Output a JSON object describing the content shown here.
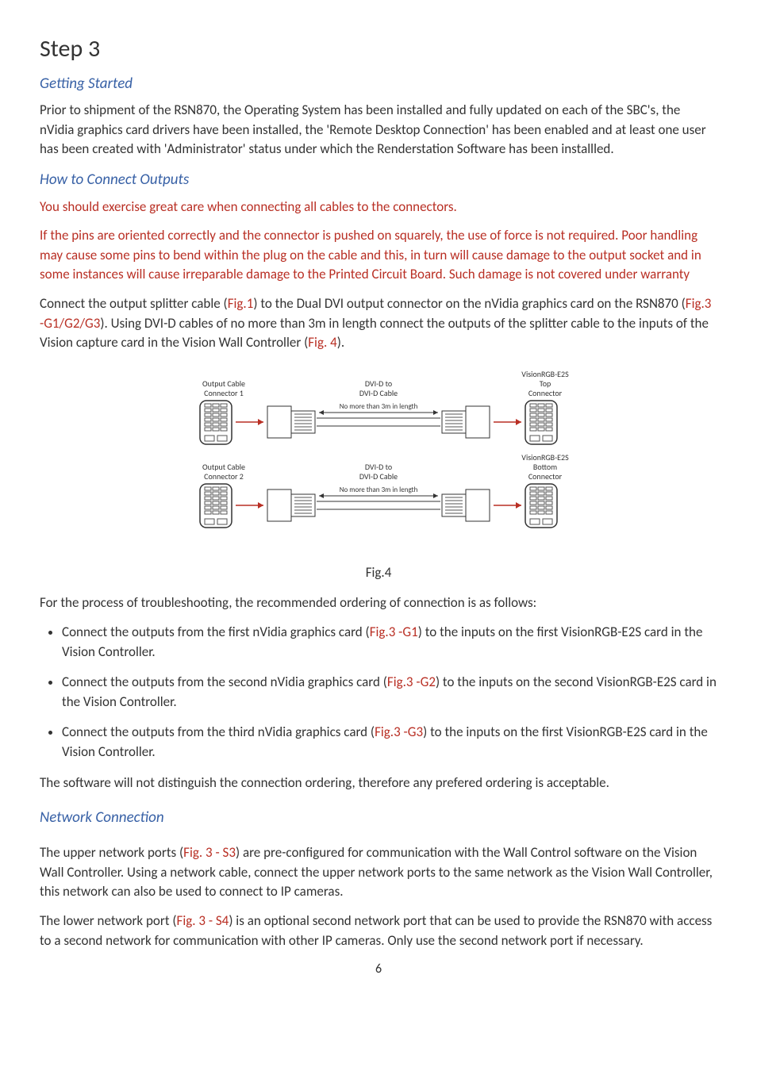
{
  "title": "Step 3",
  "sections": {
    "getting_started": {
      "heading": "Getting Started",
      "p1": "Prior to shipment of the RSN870, the Operating System has been installed and fully updated on each of the SBC's, the nVidia graphics card drivers have been installed, the 'Remote Desktop Connection' has been enabled and at least one user has been created with 'Administrator' status under which the Renderstation Software has been installled."
    },
    "how_to_connect": {
      "heading": "How to Connect Outputs",
      "warn1": "You should exercise great care when connecting all cables to the connectors.",
      "warn2": "If the pins are oriented correctly and the connector is pushed on squarely, the use of force is not required.  Poor handling may cause some pins to bend within the plug on the cable and this, in turn will cause damage to the output socket and in some instances will cause irreparable damage to the Printed Circuit Board.  Such damage is not covered under warranty",
      "p1_a": "Connect the output splitter cable (",
      "p1_ref1": "Fig.1",
      "p1_b": ") to the Dual DVI output connector on the nVidia graphics card on the RSN870 (",
      "p1_ref2": "Fig.3 -G1/G2/G3",
      "p1_c": ").  Using DVI-D cables of no more than 3m in length connect the outputs of the splitter cable to the inputs of the Vision capture card in the Vision Wall Controller (",
      "p1_ref3": "Fig. 4",
      "p1_d": ")."
    },
    "figure": {
      "labels": {
        "out_conn_1a": "Output Cable",
        "out_conn_1b": "Connector 1",
        "out_conn_2a": "Output Cable",
        "out_conn_2b": "Connector 2",
        "dvi_a": "DVI-D to",
        "dvi_b": "DVI-D  Cable",
        "no_more": "No more than 3m in length",
        "top_a": "VisionRGB-E2S",
        "top_b": "Top",
        "top_c": "Connector",
        "bot_a": "VisionRGB-E2S",
        "bot_b": "Bottom",
        "bot_c": "Connector"
      },
      "caption": "Fig.4"
    },
    "troubleshooting": {
      "intro": "For the process of troubleshooting,  the recommended ordering  of connection is as follows:",
      "b1_a": "Connect the outputs from the first nVidia graphics card (",
      "b1_ref": "Fig.3 -G1",
      "b1_b": ") to the inputs on the first VisionRGB-E2S card in the Vision Controller.",
      "b2_a": "Connect the outputs from the second nVidia graphics card (",
      "b2_ref": "Fig.3 -G2",
      "b2_b": ") to the inputs on the second VisionRGB-E2S card in the Vision Controller.",
      "b3_a": "Connect the outputs from the third nVidia graphics card (",
      "b3_ref": "Fig.3 -G3",
      "b3_b": ") to the inputs on the first VisionRGB-E2S card in the Vision Controller.",
      "note": "The software will not distinguish the connection ordering, therefore any prefered ordering is acceptable."
    },
    "network": {
      "heading": "Network Connection",
      "p1_a": "The upper network ports (",
      "p1_ref": "Fig. 3 - S3",
      "p1_b": ") are pre-configured for communication with the Wall Control software on the Vision Wall Controller.  Using a network cable, connect the upper network ports to the same network as the Vision Wall Controller, this network can also be used to connect to IP cameras.",
      "p2_a": "The lower network port (",
      "p2_ref": "Fig. 3 - S4",
      "p2_b": ") is an optional second network port that can be used to provide the RSN870 with access to a second network for communication with other IP cameras.  Only use the second network port if necessary."
    }
  },
  "page_number": "6"
}
